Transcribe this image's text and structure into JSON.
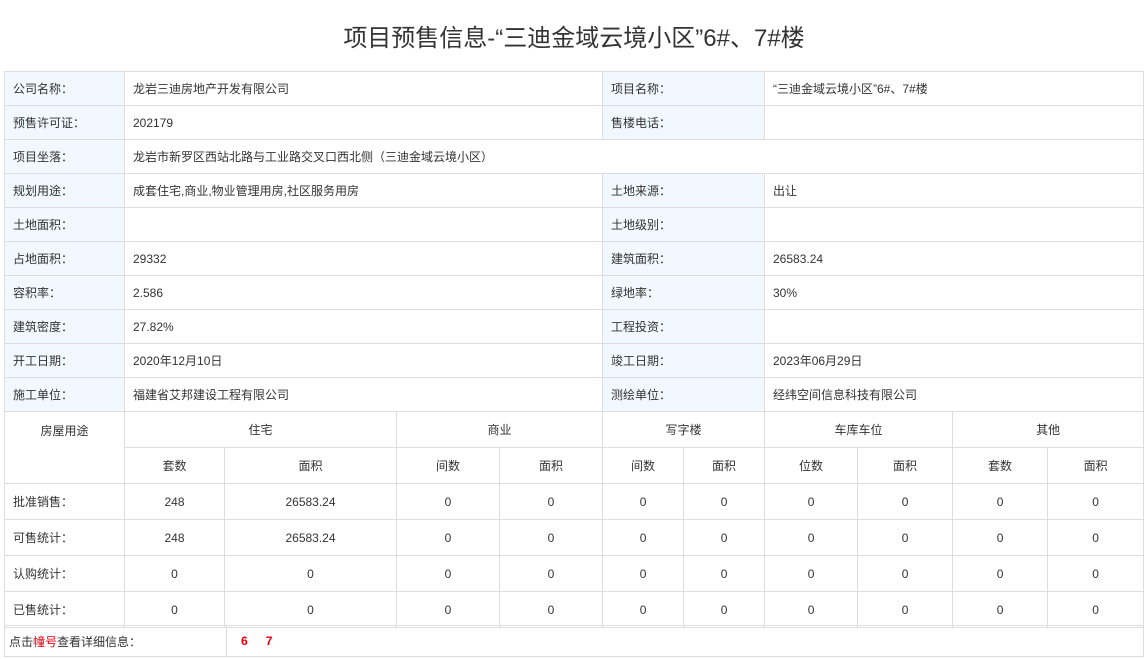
{
  "page_title": "项目预售信息-“三迪金域云境小区”6#、7#楼",
  "info": {
    "company_label": "公司名称：",
    "company": "龙岩三迪房地产开发有限公司",
    "project_label": "项目名称：",
    "project": "“三迪金域云境小区”6#、7#楼",
    "permit_label": "预售许可证：",
    "permit": "202179",
    "phone_label": "售楼电话：",
    "phone": "",
    "location_label": "项目坐落：",
    "location": "龙岩市新罗区西站北路与工业路交叉口西北侧（三迪金域云境小区）",
    "usage_label": "规划用途：",
    "usage": "成套住宅,商业,物业管理用房,社区服务用房",
    "land_source_label": "土地来源：",
    "land_source": "出让",
    "land_area_label": "土地面积：",
    "land_area": "",
    "land_grade_label": "土地级别：",
    "land_grade": "",
    "site_area_label": "占地面积：",
    "site_area": "29332",
    "building_area_label": "建筑面积：",
    "building_area": "26583.24",
    "plot_ratio_label": "容积率：",
    "plot_ratio": "2.586",
    "green_ratio_label": "绿地率：",
    "green_ratio": "30%",
    "building_density_label": "建筑密度：",
    "building_density": "27.82%",
    "investment_label": "工程投资：",
    "investment": "",
    "start_date_label": "开工日期：",
    "start_date": "2020年12月10日",
    "completion_date_label": "竣工日期：",
    "completion_date": "2023年06月29日",
    "contractor_label": "施工单位：",
    "contractor": "福建省艾邦建设工程有限公司",
    "surveyor_label": "测绘单位：",
    "surveyor": "经纬空间信息科技有限公司"
  },
  "stats": {
    "usage_header": "房屋用途",
    "groups": [
      "住宅",
      "商业",
      "写字楼",
      "车库车位",
      "其他"
    ],
    "subheaders": [
      "套数",
      "面积",
      "间数",
      "面积",
      "间数",
      "面积",
      "位数",
      "面积",
      "套数",
      "面积"
    ],
    "rows": [
      {
        "label": "批准销售：",
        "values": [
          "248",
          "26583.24",
          "0",
          "0",
          "0",
          "0",
          "0",
          "0",
          "0",
          "0"
        ]
      },
      {
        "label": "可售统计：",
        "values": [
          "248",
          "26583.24",
          "0",
          "0",
          "0",
          "0",
          "0",
          "0",
          "0",
          "0"
        ]
      },
      {
        "label": "认购统计：",
        "values": [
          "0",
          "0",
          "0",
          "0",
          "0",
          "0",
          "0",
          "0",
          "0",
          "0"
        ]
      },
      {
        "label": "已售统计：",
        "values": [
          "0",
          "0",
          "0",
          "0",
          "0",
          "0",
          "0",
          "0",
          "0",
          "0"
        ]
      }
    ]
  },
  "building_links": {
    "prefix": "点击",
    "highlight": "幢号",
    "suffix": "查看详细信息：",
    "buildings": [
      "6",
      "7"
    ]
  },
  "colors": {
    "label_bg": "#f2f8ff",
    "border": "#dddddd",
    "link_red": "#e60012"
  }
}
